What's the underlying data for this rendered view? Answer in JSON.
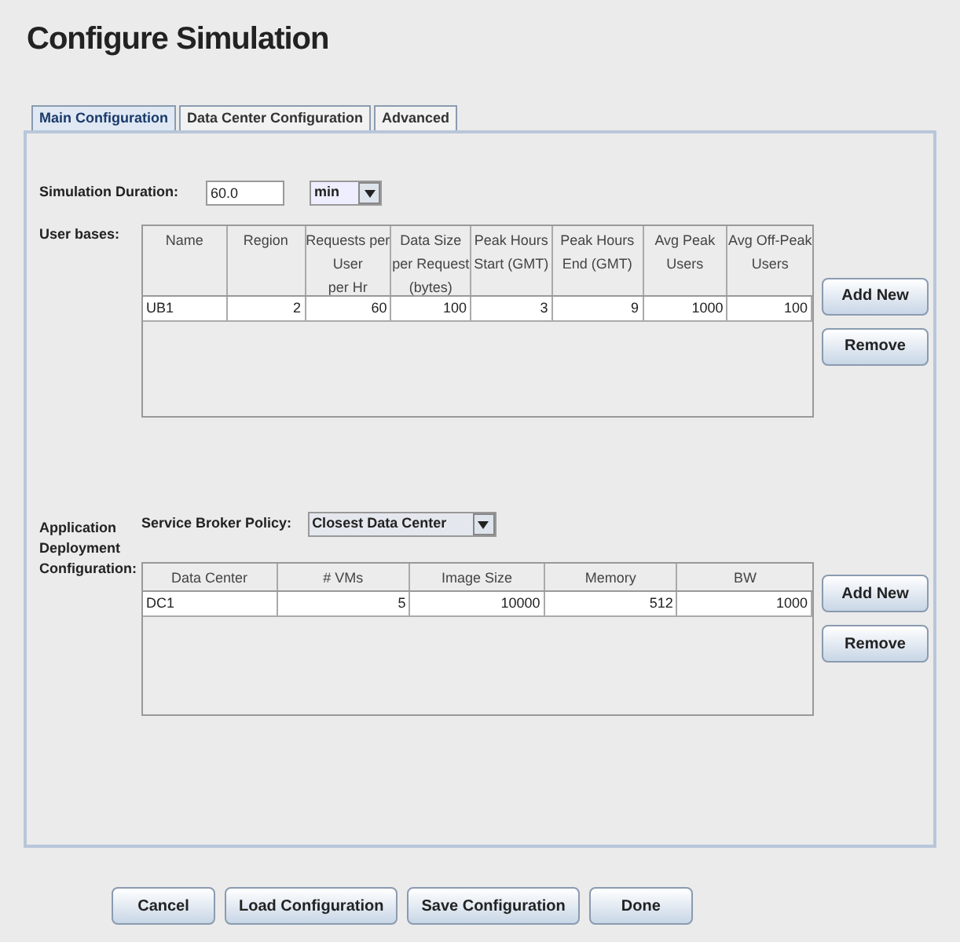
{
  "title": "Configure Simulation",
  "tabs": [
    {
      "label": "Main Configuration",
      "selected": true
    },
    {
      "label": "Data Center Configuration",
      "selected": false
    },
    {
      "label": "Advanced",
      "selected": false
    }
  ],
  "duration": {
    "label": "Simulation Duration:",
    "value": "60.0",
    "unit": "min"
  },
  "user_bases": {
    "label": "User bases:",
    "columns": [
      "Name",
      "Region",
      "Requests per\nUser\nper Hr",
      "Data Size\nper Request\n(bytes)",
      "Peak Hours\nStart (GMT)",
      "Peak Hours\nEnd (GMT)",
      "Avg Peak\nUsers",
      "Avg Off-Peak\nUsers"
    ],
    "rows": [
      [
        "UB1",
        "2",
        "60",
        "100",
        "3",
        "9",
        "1000",
        "100"
      ]
    ],
    "buttons": [
      "Add New",
      "Remove"
    ]
  },
  "deployment": {
    "label": "Application\nDeployment\nConfiguration:",
    "policy_label": "Service Broker Policy:",
    "policy": "Closest Data Center",
    "columns": [
      "Data Center",
      "# VMs",
      "Image Size",
      "Memory",
      "BW"
    ],
    "rows": [
      [
        "DC1",
        "5",
        "10000",
        "512",
        "1000"
      ]
    ],
    "buttons": [
      "Add New",
      "Remove"
    ]
  },
  "buttons": [
    "Cancel",
    "Load Configuration",
    "Save Configuration",
    "Done"
  ]
}
